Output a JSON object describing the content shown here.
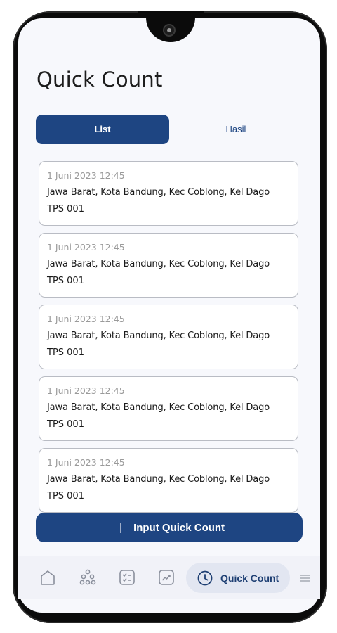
{
  "page": {
    "title": "Quick Count"
  },
  "tabs": [
    {
      "label": "List",
      "active": true
    },
    {
      "label": "Hasil",
      "active": false
    }
  ],
  "entries": [
    {
      "date": "1 Juni 2023 12:45",
      "location": "Jawa Barat, Kota Bandung, Kec Coblong, Kel Dago",
      "tps": "TPS 001"
    },
    {
      "date": "1 Juni 2023 12:45",
      "location": "Jawa Barat, Kota Bandung, Kec Coblong, Kel Dago",
      "tps": "TPS 001"
    },
    {
      "date": "1 Juni 2023 12:45",
      "location": "Jawa Barat, Kota Bandung, Kec Coblong, Kel Dago",
      "tps": "TPS 001"
    },
    {
      "date": "1 Juni 2023 12:45",
      "location": "Jawa Barat, Kota Bandung, Kec Coblong, Kel Dago",
      "tps": "TPS 001"
    },
    {
      "date": "1 Juni 2023 12:45",
      "location": "Jawa Barat, Kota Bandung, Kec Coblong, Kel Dago",
      "tps": "TPS 001"
    }
  ],
  "input_button": {
    "icon": "plus-icon",
    "label": "Input Quick Count"
  },
  "bottom_nav": {
    "items": [
      {
        "icon": "home-icon"
      },
      {
        "icon": "network-icon"
      },
      {
        "icon": "checklist-icon"
      },
      {
        "icon": "trend-chart-icon"
      },
      {
        "icon": "clock-icon",
        "label": "Quick Count",
        "active": true
      },
      {
        "icon": "menu-icon"
      }
    ]
  },
  "colors": {
    "primary": "#1e4582",
    "background": "#f7f8fc",
    "active_pill": "#e2e6f1",
    "muted_text": "#9a9a9a"
  }
}
